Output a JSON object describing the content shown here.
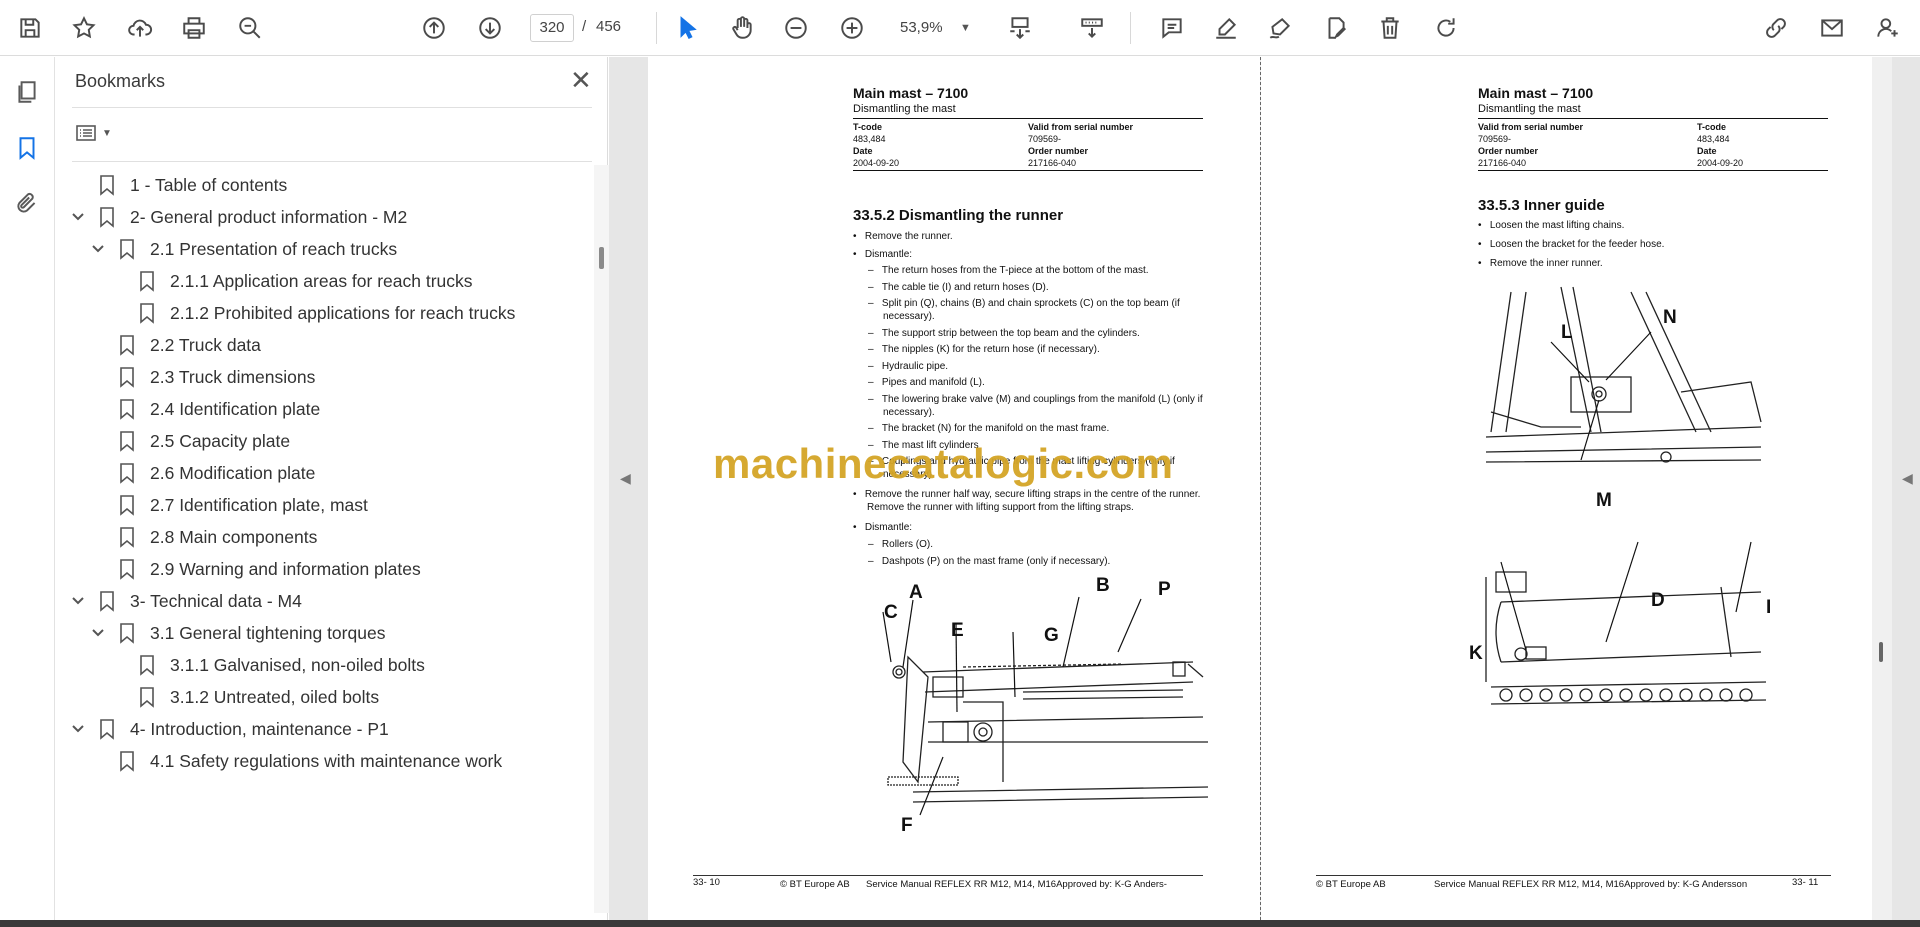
{
  "toolbar": {
    "page_current": "320",
    "page_separator": "/",
    "page_total": "456",
    "zoom": "53,9%"
  },
  "panel": {
    "title": "Bookmarks",
    "close_glyph": "✕"
  },
  "bookmarks": [
    {
      "label": "1 - Table of contents"
    },
    {
      "label": "2- General product information - M2"
    },
    {
      "label": "2.1 Presentation of reach trucks"
    },
    {
      "label": "2.1.1 Application areas for reach trucks"
    },
    {
      "label": "2.1.2 Prohibited applications for reach trucks"
    },
    {
      "label": "2.2 Truck data"
    },
    {
      "label": "2.3 Truck dimensions"
    },
    {
      "label": "2.4 Identification plate"
    },
    {
      "label": "2.5 Capacity plate"
    },
    {
      "label": "2.6 Modification plate"
    },
    {
      "label": "2.7 Identification plate, mast"
    },
    {
      "label": "2.8 Main components"
    },
    {
      "label": "2.9 Warning and information plates"
    },
    {
      "label": "3- Technical data - M4"
    },
    {
      "label": "3.1 General tightening torques"
    },
    {
      "label": "3.1.1 Galvanised, non-oiled bolts"
    },
    {
      "label": "3.1.2 Untreated, oiled bolts"
    },
    {
      "label": "4- Introduction, maintenance - P1"
    },
    {
      "label": "4.1 Safety regulations with maintenance work"
    }
  ],
  "left_page": {
    "title": "Main mast – 7100",
    "subtitle": "Dismantling the mast",
    "tcode_label": "T-code",
    "tcode": "483,484",
    "valid_label": "Valid from serial number",
    "valid": "709569-",
    "date_label": "Date",
    "date": "2004-09-20",
    "order_label": "Order number",
    "order": "217166-040",
    "section": "33.5.2 Dismantling the runner",
    "b1": "Remove the runner.",
    "b2": "Dismantle:",
    "d1": "The return hoses from the T-piece at the bottom of the mast.",
    "d2": "The cable tie (I) and return hoses (D).",
    "d3": "Split pin (Q), chains (B) and chain sprockets (C) on the top beam (if necessary).",
    "d4": "The support strip between the top beam and the cylinders.",
    "d5": "The nipples (K) for the return hose (if necessary).",
    "d6": "Hydraulic pipe.",
    "d7": "Pipes and manifold (L).",
    "d8": "The lowering brake valve (M) and couplings from the manifold (L) (only if necessary).",
    "d9": "The bracket (N) for the manifold on the mast frame.",
    "d10": "The mast lift cylinders",
    "d11": "Couplings and hydraulic pipe from the mast lifting cylinders (only if necessary).",
    "b3": "Remove the runner half way, secure lifting straps in the centre of the runner. Remove the runner with lifting support from the lifting straps.",
    "b4": "Dismantle:",
    "e1": "Rollers (O).",
    "e2": "Dashpots (P) on the mast frame (only if necessary).",
    "fig_labels": {
      "a": "A",
      "b": "B",
      "c": "C",
      "e": "E",
      "f": "F",
      "g": "G",
      "p": "P"
    },
    "foot_page": "33- 10",
    "foot_copy": "© BT Europe AB",
    "foot_manual": "Service Manual REFLEX RR M12, M14, M16Approved by: K-G Anders-"
  },
  "right_page": {
    "title": "Main mast – 7100",
    "subtitle": "Dismantling the mast",
    "valid_label": "Valid from serial number",
    "valid": "709569-",
    "tcode_label": "T-code",
    "tcode": "483,484",
    "order_label": "Order number",
    "order": "217166-040",
    "date_label": "Date",
    "date": "2004-09-20",
    "section": "33.5.3 Inner guide",
    "b1": "Loosen the mast lifting chains.",
    "b2": "Loosen the bracket for the feeder hose.",
    "b3": "Remove the inner runner.",
    "fig_labels": {
      "l": "L",
      "n": "N",
      "m": "M",
      "d": "D",
      "i": "I",
      "k": "K"
    },
    "foot_copy": "© BT Europe AB",
    "foot_manual": "Service Manual REFLEX RR M12, M14, M16Approved by: K-G Andersson",
    "foot_page": "33- 11"
  },
  "watermark": "machinecatalogic.com",
  "colors": {
    "accent": "#1473e6",
    "watermark": "#d4a526"
  }
}
